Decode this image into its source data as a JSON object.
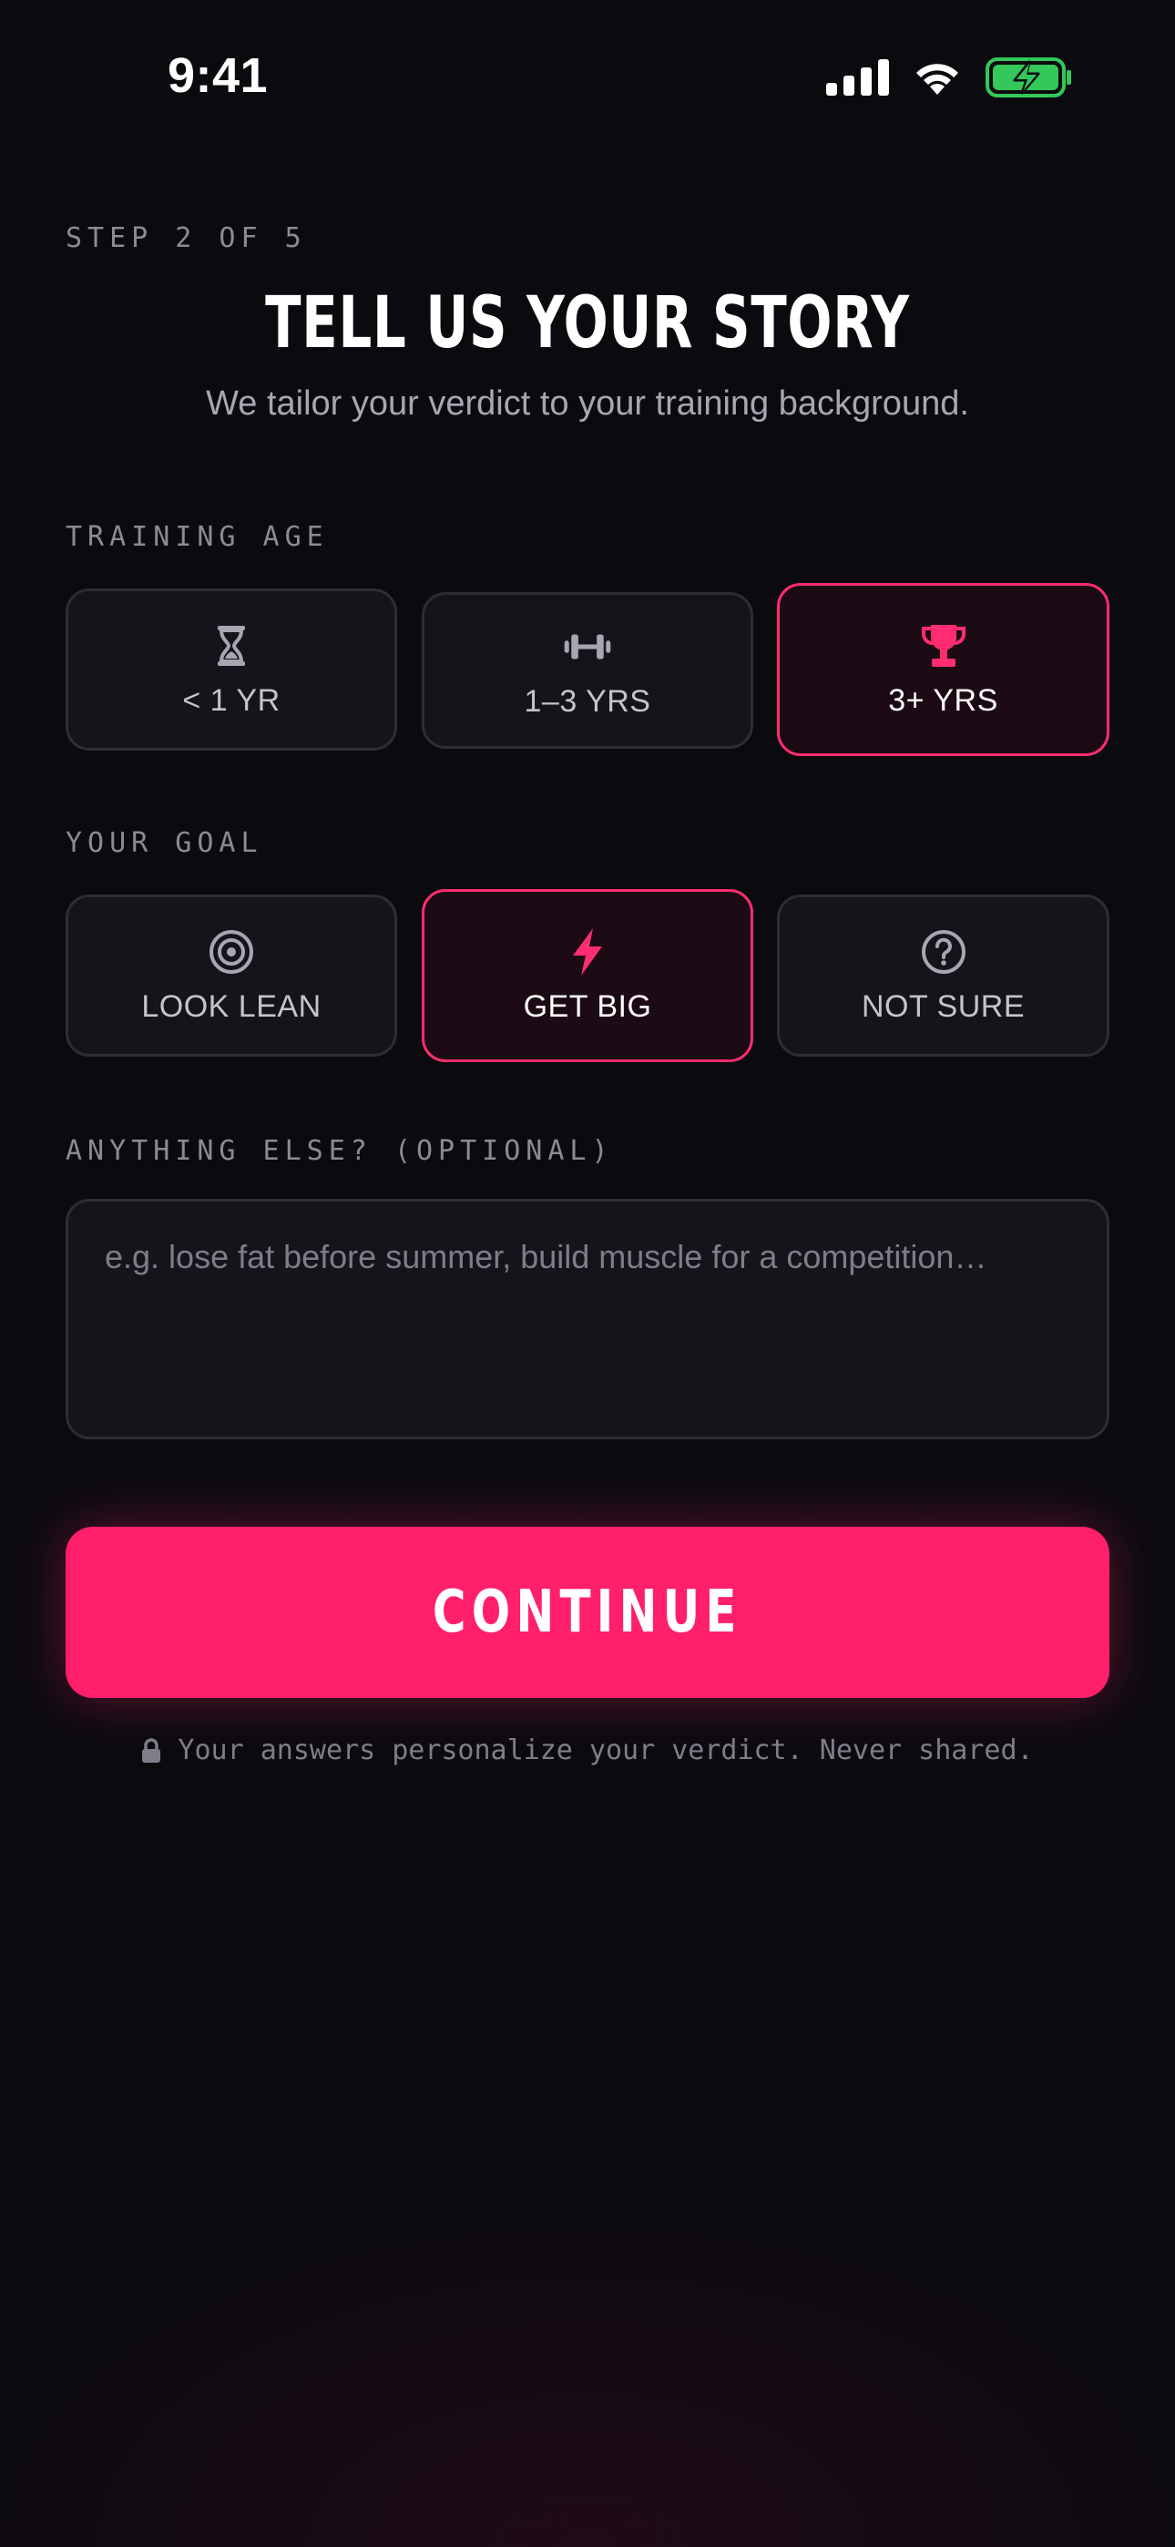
{
  "status_bar": {
    "time": "9:41"
  },
  "header": {
    "step": "STEP 2 OF 5",
    "title": "TELL US YOUR STORY",
    "subtitle": "We tailor your verdict to your training background."
  },
  "training_age": {
    "label": "TRAINING AGE",
    "options": [
      {
        "label": "< 1 YR",
        "icon": "hourglass-icon",
        "selected": false
      },
      {
        "label": "1–3 YRS",
        "icon": "dumbbell-icon",
        "selected": false
      },
      {
        "label": "3+ YRS",
        "icon": "trophy-icon",
        "selected": true
      }
    ]
  },
  "goal": {
    "label": "YOUR GOAL",
    "options": [
      {
        "label": "LOOK LEAN",
        "icon": "target-icon",
        "selected": false
      },
      {
        "label": "GET BIG",
        "icon": "lightning-icon",
        "selected": true
      },
      {
        "label": "NOT SURE",
        "icon": "question-circle-icon",
        "selected": false
      }
    ]
  },
  "notes": {
    "label": "ANYTHING ELSE? (OPTIONAL)",
    "value": "",
    "placeholder": "e.g. lose fat before summer, build muscle for a competition…"
  },
  "continue_label": "CONTINUE",
  "privacy_note": "Your answers personalize your verdict. Never shared.",
  "colors": {
    "accent": "#ff1f6a",
    "background": "#0b0b0f",
    "card": "#14151b",
    "selected_card": "#1c0b14",
    "muted_text": "#8b8b96",
    "battery_green": "#34c759"
  }
}
